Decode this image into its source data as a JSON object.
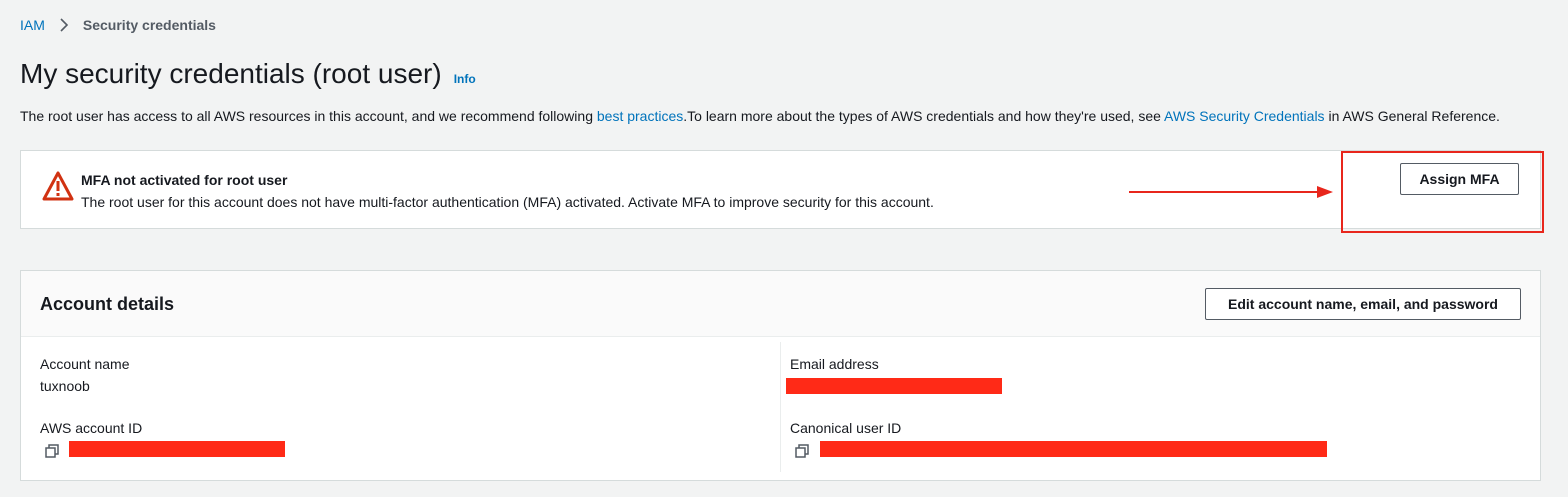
{
  "breadcrumb": {
    "root": "IAM",
    "current": "Security credentials"
  },
  "page": {
    "title": "My security credentials (root user)",
    "info_label": "Info",
    "intro": {
      "part1": "The root user has access to all AWS resources in this account, and we recommend following ",
      "link1": "best practices",
      "part2": ".To learn more about the types of AWS credentials and how they're used, see ",
      "link2": "AWS Security Credentials",
      "part3": " in AWS General Reference."
    }
  },
  "alert": {
    "icon": "warning-triangle-icon",
    "title": "MFA not activated for root user",
    "body": "The root user for this account does not have multi-factor authentication (MFA) activated. Activate MFA to improve security for this account.",
    "button_label": "Assign MFA",
    "annotation_color": "#e8261c"
  },
  "account_details": {
    "title": "Account details",
    "edit_button_label": "Edit account name, email, and password",
    "account_name_label": "Account name",
    "account_name_value": "tuxnoob",
    "aws_account_id_label": "AWS account ID",
    "email_label": "Email address",
    "canonical_user_id_label": "Canonical user ID",
    "redaction_color": "#ff2a17"
  },
  "colors": {
    "link": "#0073bb",
    "warning": "#d13212",
    "background": "#f2f3f3"
  }
}
